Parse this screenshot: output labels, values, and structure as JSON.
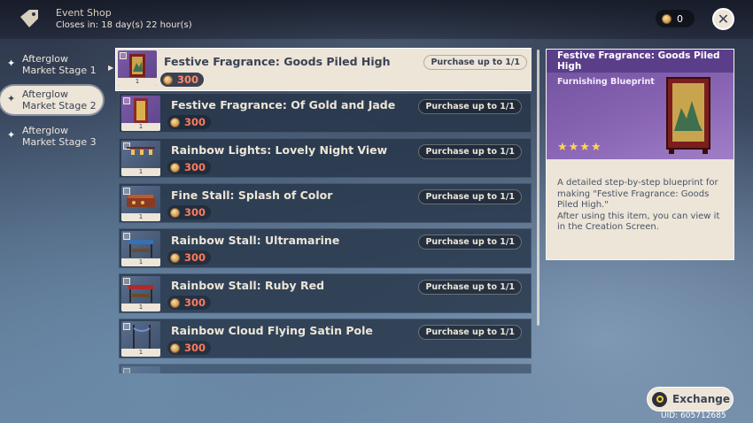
{
  "header": {
    "shop_title": "Event Shop",
    "closes_in": "Closes in: 18 day(s) 22 hour(s)",
    "currency_count": "0"
  },
  "sidebar": {
    "stages": [
      {
        "label": "Afterglow\nMarket Stage 1"
      },
      {
        "label": "Afterglow\nMarket Stage 2"
      },
      {
        "label": "Afterglow\nMarket Stage 3"
      }
    ]
  },
  "items": [
    {
      "name": "Festive Fragrance: Goods Piled High",
      "price": "300",
      "limit": "Purchase up to 1/1",
      "qty": "1"
    },
    {
      "name": "Festive Fragrance: Of Gold and Jade",
      "price": "300",
      "limit": "Purchase up to 1/1",
      "qty": "1"
    },
    {
      "name": "Rainbow Lights: Lovely Night View",
      "price": "300",
      "limit": "Purchase up to 1/1",
      "qty": "1"
    },
    {
      "name": "Fine Stall: Splash of Color",
      "price": "300",
      "limit": "Purchase up to 1/1",
      "qty": "1"
    },
    {
      "name": "Rainbow Stall: Ultramarine",
      "price": "300",
      "limit": "Purchase up to 1/1",
      "qty": "1"
    },
    {
      "name": "Rainbow Stall: Ruby Red",
      "price": "300",
      "limit": "Purchase up to 1/1",
      "qty": "1"
    },
    {
      "name": "Rainbow Cloud Flying Satin Pole",
      "price": "300",
      "limit": "Purchase up to 1/1",
      "qty": "1"
    }
  ],
  "detail": {
    "title": "Festive Fragrance: Goods Piled High",
    "type": "Furnishing Blueprint",
    "stars": "★★★★",
    "description": "A detailed step-by-step blueprint for making \"Festive Fragrance: Goods Piled High.\"\nAfter using this item, you can view it in the Creation Screen."
  },
  "footer": {
    "exchange_label": "Exchange",
    "uid": "UID: 605712685"
  },
  "colors": {
    "accent_cream": "#ece5d8",
    "price_red": "#ff7a5c",
    "rarity_purple": "#8a66b5",
    "star_gold": "#ffd35a"
  }
}
